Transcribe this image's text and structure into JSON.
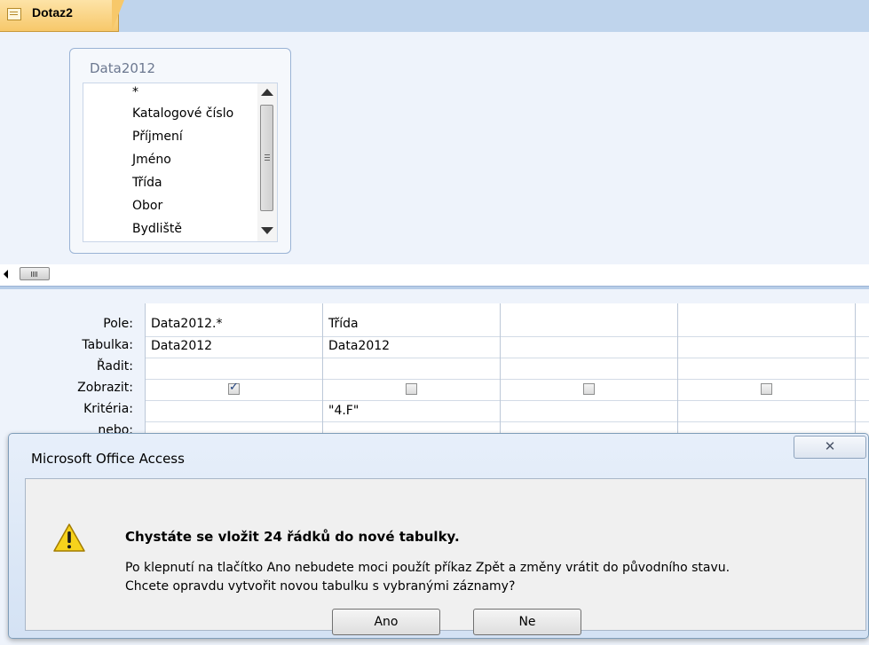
{
  "tab": {
    "label": "Dotaz2"
  },
  "table_box": {
    "title": "Data2012",
    "fields": [
      "*",
      "Katalogové číslo",
      "Příjmení",
      "Jméno",
      "Třída",
      "Obor",
      "Bydliště"
    ]
  },
  "grid": {
    "row_labels": [
      "Pole:",
      "Tabulka:",
      "Řadit:",
      "Zobrazit:",
      "Kritéria:",
      "nebo:"
    ],
    "columns": [
      {
        "pole": "Data2012.*",
        "tabulka": "Data2012",
        "zobrazit": true,
        "kriteria": ""
      },
      {
        "pole": "Třída",
        "tabulka": "Data2012",
        "zobrazit": false,
        "kriteria": "\"4.F\""
      },
      {
        "pole": "",
        "tabulka": "",
        "zobrazit": false,
        "kriteria": ""
      },
      {
        "pole": "",
        "tabulka": "",
        "zobrazit": false,
        "kriteria": ""
      }
    ]
  },
  "dialog": {
    "title": "Microsoft Office Access",
    "heading": "Chystáte se vložit 24 řádků do nové tabulky.",
    "line1": "Po klepnutí na tlačítko Ano nebudete moci použít příkaz Zpět a změny vrátit do původního stavu.",
    "line2": "Chcete opravdu vytvořit novou tabulku s vybranými záznamy?",
    "yes_label": "Ano",
    "no_label": "Ne",
    "close_glyph": "✕",
    "icon": "warning-icon"
  }
}
